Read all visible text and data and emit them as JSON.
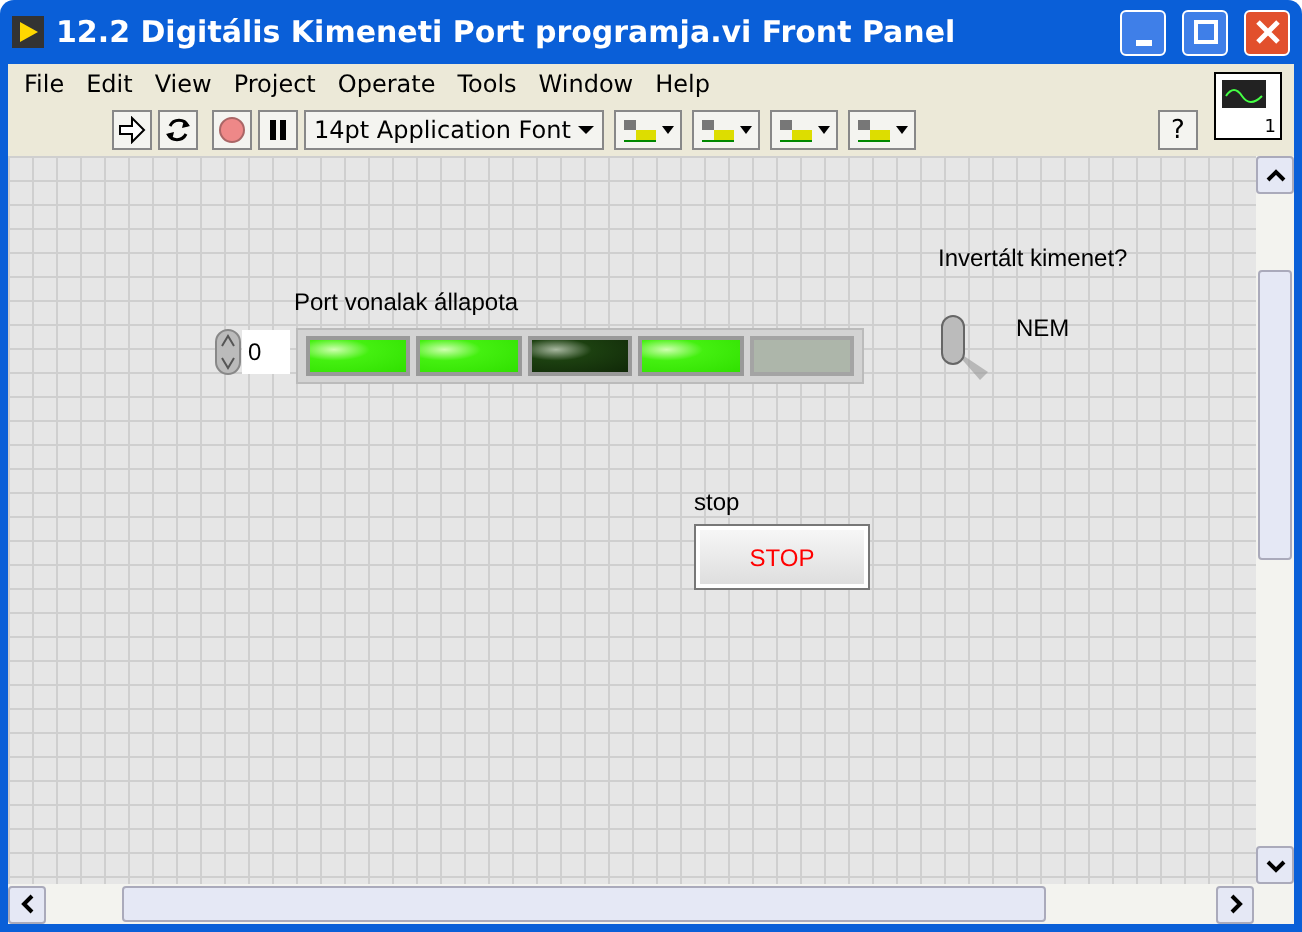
{
  "window": {
    "title": "12.2 Digitális Kimeneti Port programja.vi Front Panel"
  },
  "menu": [
    "File",
    "Edit",
    "View",
    "Project",
    "Operate",
    "Tools",
    "Window",
    "Help"
  ],
  "toolbar": {
    "font": "14pt Application Font",
    "help": "?"
  },
  "vi_icon": {
    "connector": "1"
  },
  "port_array": {
    "label": "Port vonalak állapota",
    "index": "0",
    "leds": [
      {
        "on": true,
        "disabled": false
      },
      {
        "on": true,
        "disabled": false
      },
      {
        "on": false,
        "disabled": false
      },
      {
        "on": true,
        "disabled": false
      },
      {
        "on": true,
        "disabled": true
      }
    ]
  },
  "invert": {
    "label": "Invertált kimenet?",
    "on": false,
    "state_text": "NEM"
  },
  "stop": {
    "label": "stop",
    "button": "STOP"
  }
}
